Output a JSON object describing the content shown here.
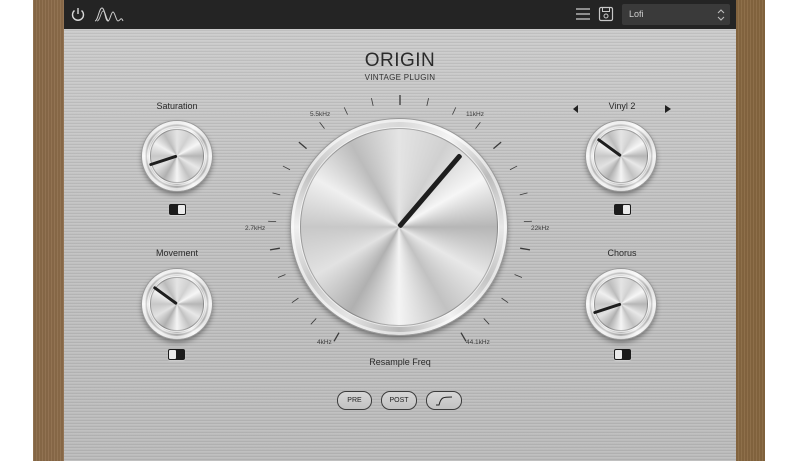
{
  "header": {
    "preset_value": "Lofi",
    "icons": [
      "power-icon",
      "waveform-logo-icon",
      "menu-icon",
      "save-icon",
      "up-down-arrows-icon"
    ]
  },
  "panel": {
    "title": "ORIGIN",
    "subtitle": "VINTAGE PLUGIN"
  },
  "knobs": {
    "saturation": {
      "label": "Saturation",
      "level": 0.1,
      "toggle_on": true
    },
    "movement": {
      "label": "Movement",
      "level": 0.3,
      "toggle_on": false
    },
    "vinyl": {
      "label": "Vinyl 2",
      "level": 0.3,
      "toggle_on": true
    },
    "chorus": {
      "label": "Chorus",
      "level": 0.1,
      "toggle_on": false
    },
    "resample": {
      "label": "Resample Freq",
      "level": 0.65,
      "scale": [
        "4kHz",
        "2.7kHz",
        "5.5kHz",
        "11kHz",
        "22kHz",
        "44.1kHz"
      ]
    }
  },
  "buttons": {
    "pre": "PRE",
    "post": "POST"
  },
  "colors": {
    "topbar": "#242424",
    "panel": "#c2c2c2",
    "wood": "#9a7752",
    "pointer": "#1e1e1e"
  }
}
